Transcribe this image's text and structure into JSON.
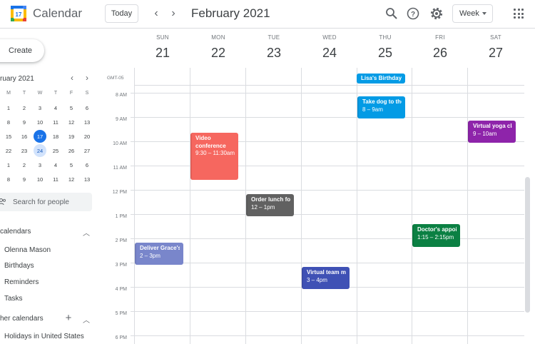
{
  "header": {
    "app_title": "Calendar",
    "logo_day": "17",
    "today_label": "Today",
    "prev_label": "‹",
    "next_label": "›",
    "month_title": "February 2021",
    "view_label": "Week"
  },
  "sidebar": {
    "create_label": "Create",
    "mini_title": "ruary 2021",
    "mini_dow": [
      "M",
      "T",
      "W",
      "T",
      "F",
      "S"
    ],
    "mini_weeks": [
      [
        "1",
        "2",
        "3",
        "4",
        "5",
        "6"
      ],
      [
        "8",
        "9",
        "10",
        "11",
        "12",
        "13"
      ],
      [
        "15",
        "16",
        "17",
        "18",
        "19",
        "20"
      ],
      [
        "22",
        "23",
        "24",
        "25",
        "26",
        "27"
      ],
      [
        "1",
        "2",
        "3",
        "4",
        "5",
        "6"
      ],
      [
        "8",
        "9",
        "10",
        "11",
        "12",
        "13"
      ]
    ],
    "search_placeholder": "Search for people",
    "my_calendars_title": "calendars",
    "my_calendars": [
      "Olenna Mason",
      "Birthdays",
      "Reminders",
      "Tasks"
    ],
    "other_calendars_title": "her calendars",
    "other_calendars": [
      "Holidays in United States"
    ]
  },
  "week": {
    "days": [
      {
        "dow": "SUN",
        "num": "21"
      },
      {
        "dow": "MON",
        "num": "22"
      },
      {
        "dow": "TUE",
        "num": "23"
      },
      {
        "dow": "WED",
        "num": "24"
      },
      {
        "dow": "THU",
        "num": "25"
      },
      {
        "dow": "FRI",
        "num": "26"
      },
      {
        "dow": "SAT",
        "num": "27"
      }
    ],
    "timezone": "GMT-05",
    "hours": [
      "8 AM",
      "9 AM",
      "10 AM",
      "11 AM",
      "12 PM",
      "1 PM",
      "2 PM",
      "3 PM",
      "4 PM",
      "5 PM",
      "6 PM"
    ],
    "allday_event": "Lisa's Birthday",
    "events": [
      {
        "title": "Video conference",
        "time": "9:30 – 11:30am",
        "color": "#f6675f"
      },
      {
        "title": "Order lunch for office",
        "time": "12 – 1pm",
        "color": "#616161"
      },
      {
        "title": "Deliver Grace's gift",
        "time": "2 – 3pm",
        "color": "#7986cb"
      },
      {
        "title": "Virtual team meeting",
        "time": "3 – 4pm",
        "color": "#3f51b5"
      },
      {
        "title": "Take dog to the vet",
        "time": "8 – 9am",
        "color": "#039be5"
      },
      {
        "title": "Doctor's appointment",
        "time": "1:15 – 2:15pm",
        "color": "#0b8043"
      },
      {
        "title": "Virtual yoga class",
        "time": "9 – 10am",
        "color": "#8e24aa"
      }
    ]
  },
  "colors": {
    "accent": "#1a73e8",
    "birthday": "#039be5"
  }
}
